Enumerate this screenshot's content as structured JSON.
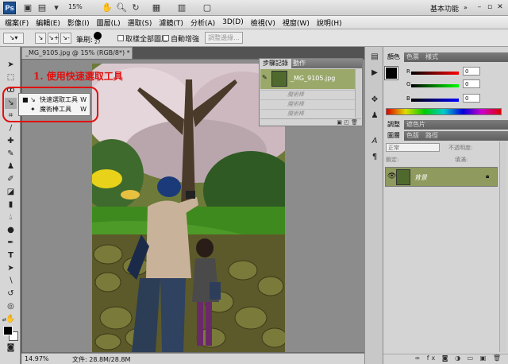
{
  "appbar": {
    "logo": "Ps",
    "zoom": "15%",
    "workspace": "基本功能",
    "icons": [
      "hand-icon",
      "zoom-icon",
      "rotate-view-icon",
      "grid-icon",
      "arrange-docs-icon",
      "screen-mode-icon"
    ]
  },
  "menu": [
    "檔案(F)",
    "編輯(E)",
    "影像(I)",
    "圖層(L)",
    "選取(S)",
    "濾鏡(T)",
    "分析(A)",
    "3D(D)",
    "檢視(V)",
    "視窗(W)",
    "說明(H)"
  ],
  "options": {
    "brush_label": "筆刷:",
    "brush_size": "27",
    "sample_all": "取樣全部圖層",
    "auto_enhance": "自動增強",
    "refine_edge": "調整邊緣..."
  },
  "document": {
    "tab_title": "_MG_9105.jpg @ 15% (RGB/8*) *",
    "zoom_status": "14.97%",
    "doc_size": "文件: 28.8M/28.8M"
  },
  "annotation": "1. 使用快速選取工具",
  "flyout": [
    {
      "label": "快速選取工具",
      "key": "W"
    },
    {
      "label": "魔術棒工具",
      "key": "W"
    }
  ],
  "history": {
    "tabs": [
      "步驟記錄",
      "動作"
    ],
    "snapshot": "_MG_9105.jpg",
    "steps": [
      "魔術棒",
      "魔術棒",
      "魔術棒"
    ]
  },
  "color_panel": {
    "tabs": [
      "顏色",
      "色票",
      "樣式"
    ],
    "channels": [
      {
        "label": "R",
        "value": "0",
        "color": "#d01010"
      },
      {
        "label": "G",
        "value": "0",
        "color": "#10b010"
      },
      {
        "label": "B",
        "value": "0",
        "color": "#1030d0"
      }
    ]
  },
  "adjust_panel": {
    "tabs": [
      "調整",
      "遮色片"
    ]
  },
  "layers_panel": {
    "tabs": [
      "圖層",
      "色版",
      "路徑"
    ],
    "blend_mode": "正常",
    "opacity_label": "不透明度:",
    "lock_label": "鎖定:",
    "fill_label": "填滿:",
    "layer_name": "背景"
  }
}
